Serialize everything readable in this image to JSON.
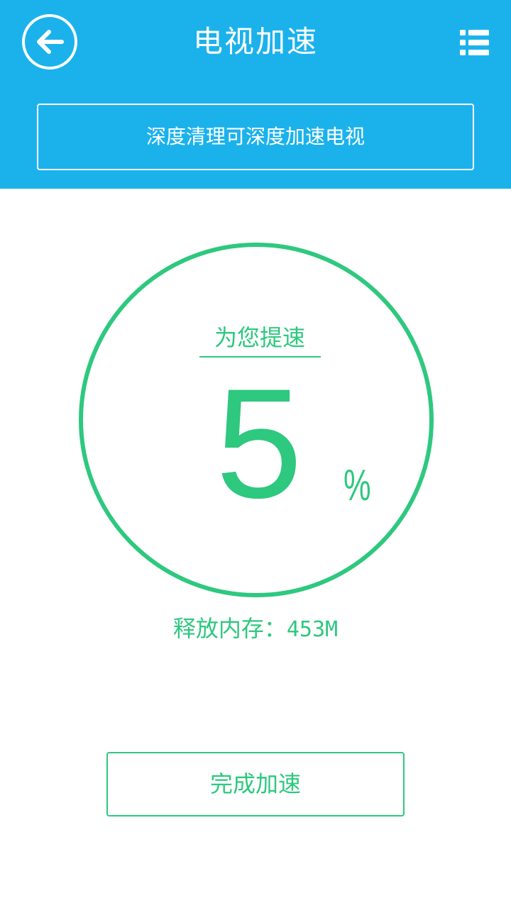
{
  "header": {
    "title": "电视加速",
    "back_icon": "arrow-left-circle-icon",
    "menu_icon": "list-menu-icon",
    "info_text": "深度清理可深度加速电视",
    "background_color": "#1bb2ec"
  },
  "gauge": {
    "label": "为您提速",
    "value": "5",
    "unit": "%",
    "color": "#2ec87f"
  },
  "memory": {
    "label": "释放内存：",
    "value": "453M"
  },
  "actions": {
    "done_label": "完成加速"
  }
}
